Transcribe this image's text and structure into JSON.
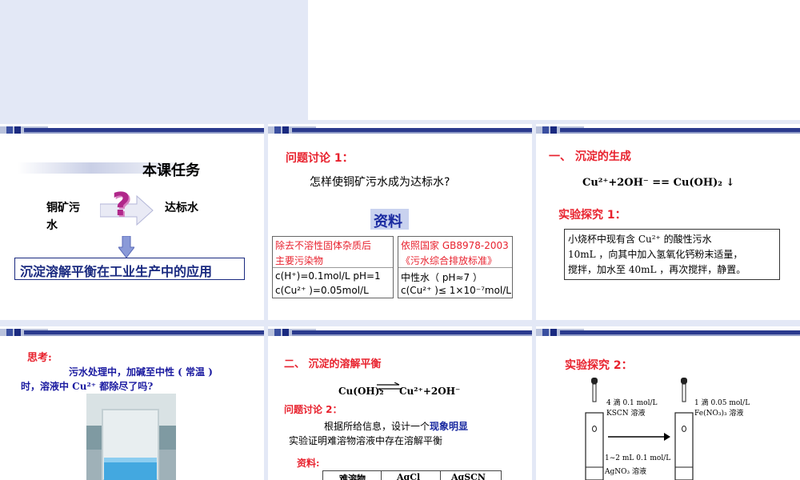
{
  "slides": [
    {
      "task_title": "本课任务",
      "left_label_1": "铜矿污",
      "left_label_2": "水",
      "right_label": "达标水",
      "question_mark": "?",
      "footer_box": "沉淀溶解平衡在工业生产中的应用"
    },
    {
      "heading": "问题讨论 1：",
      "question": "怎样使铜矿污水成为达标水?",
      "resource_title": "资料",
      "left_box_title_1": "除去不溶性固体杂质后",
      "left_box_title_2": "主要污染物",
      "left_row_1": "c(H⁺)=0.1mol/L  pH=1",
      "left_row_2": "c(Cu²⁺ )=0.05mol/L",
      "right_box_title_1": "依照国家 GB8978-2003",
      "right_box_title_2": "《污水综合排放标准》",
      "right_row_1": "中性水（ pH≈7 ）",
      "right_row_2": "c(Cu²⁺ )≤ 1×10⁻⁷mol/L"
    },
    {
      "heading": "一、 沉淀的生成",
      "equation": "Cu²⁺+2OH⁻ == Cu(OH)₂ ↓",
      "experiment_title": "实验探究 1：",
      "exp_line_1": "小烧杯中现有含 Cu²⁺ 的酸性污水",
      "exp_line_2": "10mL ，向其中加入氢氧化钙粉末适量，",
      "exp_line_3": "搅拌，加水至 40mL ，再次搅拌，静置。"
    },
    {
      "heading": "思考:",
      "line_1": "污水处理中，加碱至中性 ( 常温 )",
      "line_2": "时，溶液中 Cu²⁺ 都除尽了吗?"
    },
    {
      "heading": "二、 沉淀的溶解平衡",
      "eq_left": "Cu(OH)₂",
      "eq_right": "Cu²⁺+2OH⁻",
      "discussion": "问题讨论 2：",
      "line_1_a": "根据所给信息，设计一个",
      "line_1_b": "现象明显",
      "line_2": "实验证明难溶物溶液中存在溶解平衡",
      "resource": "资料:",
      "table_headers": [
        "难溶物",
        "AgCl",
        "AgSCN"
      ]
    },
    {
      "heading": "实验探究 2：",
      "left_reagent_1": "4 滴 0.1 mol/L",
      "left_reagent_2": "KSCN 溶液",
      "right_reagent_1": "1 滴 0.05 mol/L",
      "right_reagent_2": "Fe(NO₃)₃ 溶液",
      "bottom_reagent_1": "1~2 mL 0.1 mol/L",
      "bottom_reagent_2": "AgNO₃ 溶液"
    }
  ]
}
